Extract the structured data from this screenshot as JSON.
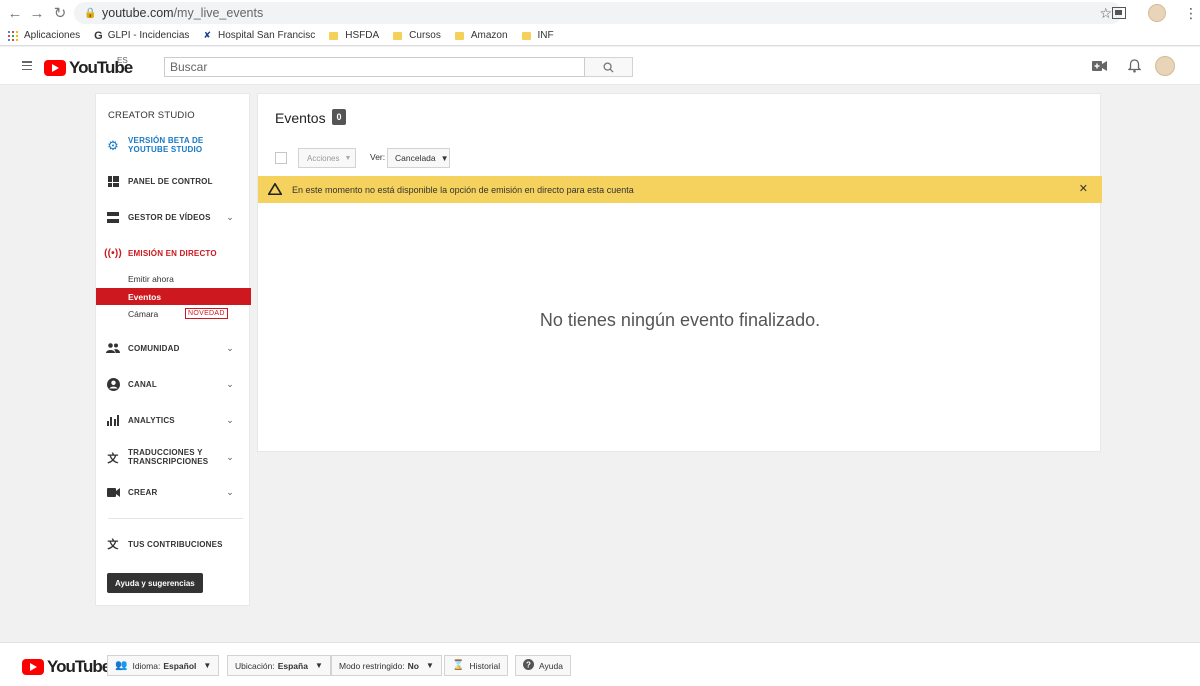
{
  "browser": {
    "url_host": "youtube.com",
    "url_path": "/my_live_events",
    "bookmarks": [
      "Aplicaciones",
      "GLPI - Incidencias",
      "Hospital San Francisc",
      "HSFDA",
      "Cursos",
      "Amazon",
      "INF"
    ]
  },
  "header": {
    "logo_text": "YouTube",
    "country": "ES",
    "search_placeholder": "Buscar"
  },
  "sidebar": {
    "title": "CREATOR STUDIO",
    "beta_line1": "VERSIÓN BETA DE",
    "beta_line2": "YOUTUBE STUDIO",
    "panel": "PANEL DE CONTROL",
    "gestor": "GESTOR DE VÍDEOS",
    "emision": "EMISIÓN EN DIRECTO",
    "sub_emitir": "Emitir ahora",
    "sub_eventos": "Eventos",
    "sub_camara": "Cámara",
    "badge_novedad": "NOVEDAD",
    "comunidad": "COMUNIDAD",
    "canal": "CANAL",
    "analytics": "ANALYTICS",
    "traducciones_line1": "TRADUCCIONES Y",
    "traducciones_line2": "TRANSCRIPCIONES",
    "crear": "CREAR",
    "contribuciones": "TUS CONTRIBUCIONES",
    "help": "Ayuda y sugerencias"
  },
  "main": {
    "title": "Eventos",
    "count": "0",
    "acciones": "Acciones",
    "ver_label": "Ver:",
    "ver_value": "Cancelada",
    "warning": "En este momento no está disponible la opción de emisión en directo para esta cuenta",
    "empty": "No tienes ningún evento finalizado."
  },
  "footer": {
    "logo_text": "YouTube",
    "idioma_label": "Idioma:",
    "idioma_value": "Español",
    "ubicacion_label": "Ubicación:",
    "ubicacion_value": "España",
    "modo_label": "Modo restringido:",
    "modo_value": "No",
    "historial": "Historial",
    "ayuda": "Ayuda"
  },
  "colors": {
    "brand_red": "#ff0000",
    "active_red": "#cc181e",
    "link_blue": "#167ac6",
    "warning_yellow": "#f5d25d"
  }
}
